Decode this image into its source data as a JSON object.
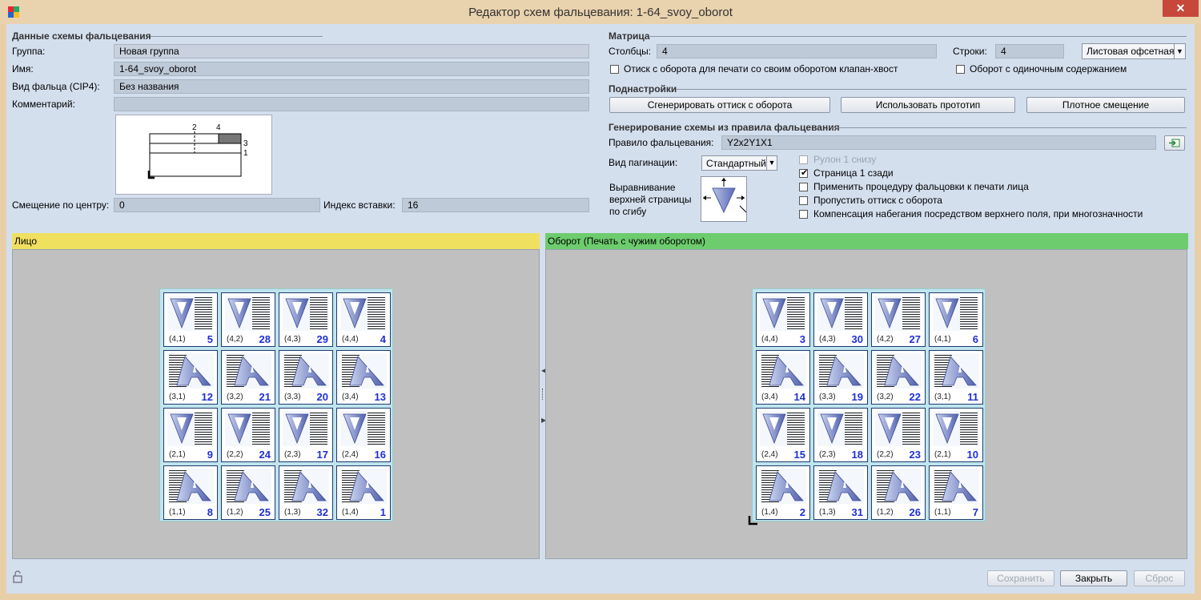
{
  "window": {
    "title": "Редактор схем фальцевания: 1-64_svoy_oborot",
    "close_glyph": "✕"
  },
  "data_section": {
    "header": "Данные схемы фальцевания",
    "group_label": "Группа:",
    "group_value": "Новая группа",
    "name_label": "Имя:",
    "name_value": "1-64_svoy_oborot",
    "fold_label": "Вид фальца (CIP4):",
    "fold_value": "Без названия",
    "comment_label": "Комментарий:",
    "comment_value": "",
    "offset_label": "Смещение по центру:",
    "offset_value": "0",
    "insert_label": "Индекс вставки:",
    "insert_value": "16",
    "preview_labels": [
      "2",
      "4",
      "3",
      "1"
    ]
  },
  "matrix": {
    "header": "Матрица",
    "cols_label": "Столбцы:",
    "cols_value": "4",
    "rows_label": "Строки:",
    "rows_value": "4",
    "press_type": "Листовая офсетная",
    "chk_backside": {
      "label": "Отиск с оборота для печати со своим оборотом клапан-хвост",
      "checked": false
    },
    "chk_single": {
      "label": "Оборот с одиночным содержанием",
      "checked": false
    }
  },
  "subsettings": {
    "header": "Поднастройки",
    "btn_generate": "Сгенерировать оттиск с оборота",
    "btn_prototype": "Использовать прототип",
    "btn_shift": "Плотное смещение"
  },
  "rule_section": {
    "header": "Генерирование схемы из правила фальцевания",
    "rule_label": "Правило фальцевания:",
    "rule_value": "Y2x2Y1X1",
    "pag_label": "Вид пагинации:",
    "pag_value": "Стандартный",
    "align_label_1": "Выравнивание",
    "align_label_2": "верхней страницы",
    "align_label_3": "по сгибу",
    "opts": [
      {
        "label": "Рулон 1 снизу",
        "checked": false,
        "disabled": true
      },
      {
        "label": "Страница 1 сзади",
        "checked": true,
        "disabled": false
      },
      {
        "label": "Применить процедуру фальцовки к печати лица",
        "checked": false,
        "disabled": false
      },
      {
        "label": "Пропустить оттиск с оборота",
        "checked": false,
        "disabled": false
      },
      {
        "label": "Компенсация набегания посредством верхнего поля, при многозначности",
        "checked": false,
        "disabled": false
      }
    ]
  },
  "front": {
    "header": "Лицо",
    "header_color": "#f0e060",
    "cells": [
      [
        {
          "c": "(4,1)",
          "n": "5",
          "k": "V"
        },
        {
          "c": "(4,2)",
          "n": "28",
          "k": "V"
        },
        {
          "c": "(4,3)",
          "n": "29",
          "k": "V"
        },
        {
          "c": "(4,4)",
          "n": "4",
          "k": "V"
        }
      ],
      [
        {
          "c": "(3,1)",
          "n": "12",
          "k": "A"
        },
        {
          "c": "(3,2)",
          "n": "21",
          "k": "A"
        },
        {
          "c": "(3,3)",
          "n": "20",
          "k": "A"
        },
        {
          "c": "(3,4)",
          "n": "13",
          "k": "A"
        }
      ],
      [
        {
          "c": "(2,1)",
          "n": "9",
          "k": "V"
        },
        {
          "c": "(2,2)",
          "n": "24",
          "k": "V"
        },
        {
          "c": "(2,3)",
          "n": "17",
          "k": "V"
        },
        {
          "c": "(2,4)",
          "n": "16",
          "k": "V"
        }
      ],
      [
        {
          "c": "(1,1)",
          "n": "8",
          "k": "A"
        },
        {
          "c": "(1,2)",
          "n": "25",
          "k": "A"
        },
        {
          "c": "(1,3)",
          "n": "32",
          "k": "A"
        },
        {
          "c": "(1,4)",
          "n": "1",
          "k": "A"
        }
      ]
    ]
  },
  "back": {
    "header": "Оборот (Печать с чужим оборотом)",
    "header_color": "#6dcc6d",
    "cells": [
      [
        {
          "c": "(4,4)",
          "n": "3",
          "k": "V"
        },
        {
          "c": "(4,3)",
          "n": "30",
          "k": "V"
        },
        {
          "c": "(4,2)",
          "n": "27",
          "k": "V"
        },
        {
          "c": "(4,1)",
          "n": "6",
          "k": "V"
        }
      ],
      [
        {
          "c": "(3,4)",
          "n": "14",
          "k": "A"
        },
        {
          "c": "(3,3)",
          "n": "19",
          "k": "A"
        },
        {
          "c": "(3,2)",
          "n": "22",
          "k": "A"
        },
        {
          "c": "(3,1)",
          "n": "11",
          "k": "A"
        }
      ],
      [
        {
          "c": "(2,4)",
          "n": "15",
          "k": "V"
        },
        {
          "c": "(2,3)",
          "n": "18",
          "k": "V"
        },
        {
          "c": "(2,2)",
          "n": "23",
          "k": "V"
        },
        {
          "c": "(2,1)",
          "n": "10",
          "k": "V"
        }
      ],
      [
        {
          "c": "(1,4)",
          "n": "2",
          "k": "A"
        },
        {
          "c": "(1,3)",
          "n": "31",
          "k": "A"
        },
        {
          "c": "(1,2)",
          "n": "26",
          "k": "A"
        },
        {
          "c": "(1,1)",
          "n": "7",
          "k": "A"
        }
      ]
    ]
  },
  "footer": {
    "save": "Сохранить",
    "close": "Закрыть",
    "reset": "Сброс",
    "lock_icon": "lock-icon"
  }
}
